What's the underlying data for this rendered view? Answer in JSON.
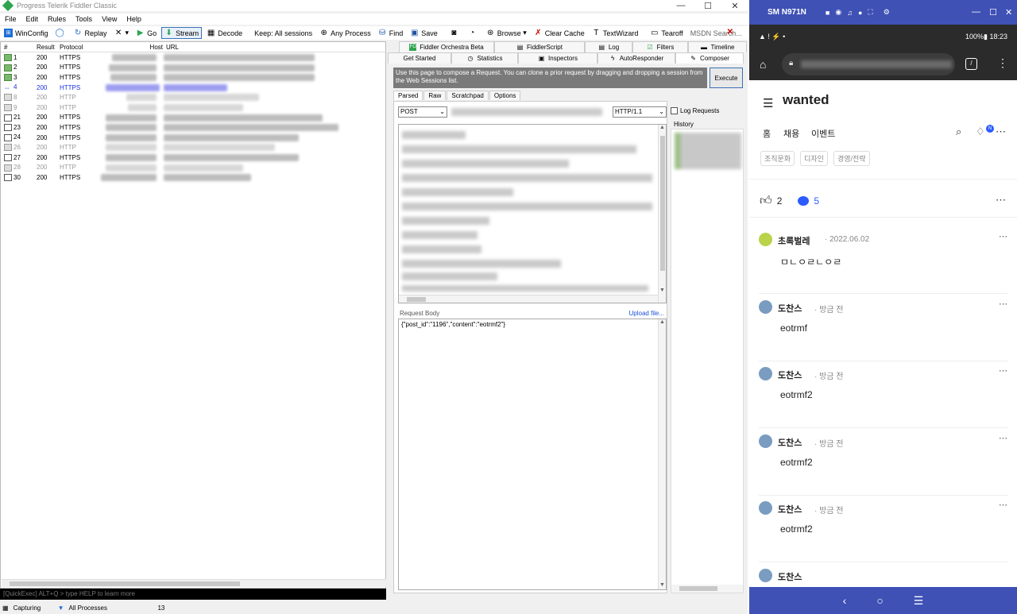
{
  "fiddler": {
    "title": "Progress Telerik Fiddler Classic",
    "menu": [
      "File",
      "Edit",
      "Rules",
      "Tools",
      "View",
      "Help"
    ],
    "toolbar": {
      "winconfig": "WinConfig",
      "replay": "Replay",
      "go": "Go",
      "stream": "Stream",
      "decode": "Decode",
      "keep": "Keep: All sessions",
      "any_process": "Any Process",
      "find": "Find",
      "save": "Save",
      "browse": "Browse",
      "clear_cache": "Clear Cache",
      "textwizard": "TextWizard",
      "tearoff": "Tearoff",
      "msdn_search": "MSDN Search...",
      "close_x": "✕"
    },
    "sessions": {
      "headers": {
        "num": "#",
        "result": "Result",
        "protocol": "Protocol",
        "host": "Host",
        "url": "URL"
      },
      "rows": [
        {
          "num": "1",
          "result": "200",
          "protocol": "HTTPS",
          "state": "normal",
          "icon": "green"
        },
        {
          "num": "2",
          "result": "200",
          "protocol": "HTTPS",
          "state": "normal",
          "icon": "green"
        },
        {
          "num": "3",
          "result": "200",
          "protocol": "HTTPS",
          "state": "normal",
          "icon": "green"
        },
        {
          "num": "4",
          "result": "200",
          "protocol": "HTTPS",
          "state": "selected",
          "icon": "blue"
        },
        {
          "num": "8",
          "result": "200",
          "protocol": "HTTP",
          "state": "dim",
          "icon": "lock"
        },
        {
          "num": "9",
          "result": "200",
          "protocol": "HTTP",
          "state": "dim",
          "icon": "lock"
        },
        {
          "num": "21",
          "result": "200",
          "protocol": "HTTPS",
          "state": "normal",
          "icon": "web"
        },
        {
          "num": "23",
          "result": "200",
          "protocol": "HTTPS",
          "state": "normal",
          "icon": "web"
        },
        {
          "num": "24",
          "result": "200",
          "protocol": "HTTPS",
          "state": "normal",
          "icon": "web"
        },
        {
          "num": "26",
          "result": "200",
          "protocol": "HTTP",
          "state": "dim",
          "icon": "lock"
        },
        {
          "num": "27",
          "result": "200",
          "protocol": "HTTPS",
          "state": "normal",
          "icon": "web"
        },
        {
          "num": "28",
          "result": "200",
          "protocol": "HTTP",
          "state": "dim",
          "icon": "lock"
        },
        {
          "num": "30",
          "result": "200",
          "protocol": "HTTPS",
          "state": "normal",
          "icon": "web"
        }
      ]
    },
    "quickexec_placeholder": "[QuickExec] ALT+Q > type HELP to learn more",
    "status": {
      "capturing": "Capturing",
      "processes": "All Processes",
      "count": "13"
    },
    "tabs_row1": [
      "Fiddler Orchestra Beta",
      "FiddlerScript",
      "Log",
      "Filters",
      "Timeline"
    ],
    "tabs_row2": [
      "Get Started",
      "Statistics",
      "Inspectors",
      "AutoResponder",
      "Composer"
    ],
    "composer": {
      "info": "Use this page to compose a Request. You can clone a prior request by dragging and dropping a session from the Web Sessions list.",
      "execute": "Execute",
      "subtabs": [
        "Parsed",
        "Raw",
        "Scratchpad",
        "Options"
      ],
      "method": "POST",
      "version": "HTTP/1.1",
      "log_requests": "Log Requests",
      "history": "History",
      "request_body_label": "Request Body",
      "upload_file": "Upload file...",
      "request_body": "{\"post_id\":\"1196\",\"content\":\"eotrmf2\"}"
    }
  },
  "phone": {
    "device": "SM N971N",
    "status_right": "100%▮ 18:23",
    "app": {
      "brand": "wanted",
      "nav": [
        "홈",
        "채용",
        "이벤트"
      ],
      "badge": "N",
      "chips": [
        "조직문화",
        "디자인",
        "경영/전략"
      ],
      "likes": "2",
      "comments_count": "5",
      "comments": [
        {
          "name": "초록벌레",
          "meta": "· 2022.06.02",
          "text": "ㅁㄴㅇㄹㄴㅇㄹ",
          "avatar": "green"
        },
        {
          "name": "도찬스",
          "meta": "· 방금 전",
          "text": "eotrmf",
          "avatar": "blue"
        },
        {
          "name": "도찬스",
          "meta": "· 방금 전",
          "text": "eotrmf2",
          "avatar": "blue"
        },
        {
          "name": "도찬스",
          "meta": "· 방금 전",
          "text": "eotrmf2",
          "avatar": "blue"
        },
        {
          "name": "도찬스",
          "meta": "· 방금 전",
          "text": "eotrmf2",
          "avatar": "blue"
        },
        {
          "name": "도찬스",
          "meta": "",
          "text": "",
          "avatar": "blue"
        }
      ]
    }
  },
  "colors": {
    "accent_blue": "#3f51b5",
    "brand_blue": "#2c5bff",
    "selection": "#1a2ee0"
  }
}
